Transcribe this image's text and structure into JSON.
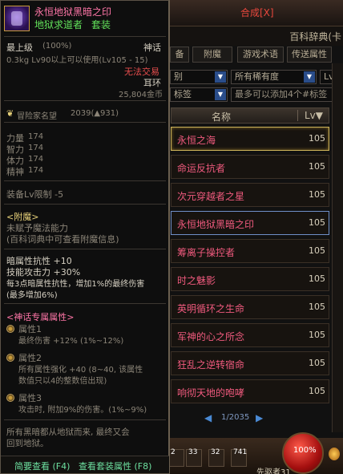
{
  "bg": {
    "title": "合成[X]",
    "subtitle": "百科辞典(卡",
    "tabs": [
      "备",
      "附魔",
      "游戏术语",
      "传送属性"
    ],
    "filters": {
      "left": "别",
      "rarity": "所有稀有度",
      "level": "Lv",
      "tag_left": "标签",
      "tag_right": "最多可以添加4个#标签"
    },
    "columns": {
      "name": "名称",
      "lv": "Lv▼"
    },
    "rows": [
      {
        "name": "永恒之海",
        "lv": "105"
      },
      {
        "name": "命运反抗者",
        "lv": "105"
      },
      {
        "name": "次元穿越者之星",
        "lv": "105"
      },
      {
        "name": "永恒地狱黑暗之印",
        "lv": "105"
      },
      {
        "name": "筹离子操控者",
        "lv": "105"
      },
      {
        "name": "时之魅影",
        "lv": "105"
      },
      {
        "name": "英明循环之生命",
        "lv": "105"
      },
      {
        "name": "军神的心之所念",
        "lv": "105"
      },
      {
        "name": "狂乱之逆转宿命",
        "lv": "105"
      },
      {
        "name": "响彻天地的咆哮",
        "lv": "105"
      }
    ],
    "pager": {
      "text": "1/2035",
      "prev": "◀",
      "next": "▶"
    },
    "hud": {
      "slots": [
        "2",
        "33",
        "32",
        "741"
      ],
      "hp": "100%",
      "fatigue": "先驱者31"
    }
  },
  "tooltip": {
    "name": "永恒地狱黑暗之印",
    "set": "地狱求道者",
    "set_tag": "套装",
    "grade": "最上级",
    "grade_pct": "(100%)",
    "rarity": "神话",
    "weight_req": "0.3kg  Lv90以上可以使用(Lv105 - 15)",
    "trade": "无法交易",
    "slot": "耳环",
    "price": "25,804金币",
    "fame_label": "冒险家名望",
    "fame_value": "2039(▲931)",
    "stats": [
      {
        "label": "力量",
        "value": "174"
      },
      {
        "label": "智力",
        "value": "174"
      },
      {
        "label": "体力",
        "value": "174"
      },
      {
        "label": "精神",
        "value": "174"
      }
    ],
    "lv_limit": "装备Lv限制 -5",
    "enchant_header": "<附魔>",
    "enchant_line1": "未赋予魔法能力",
    "enchant_line2": "(百科词典中可查看附魔信息)",
    "effects": [
      "暗属性抗性 +10",
      "技能攻击力 +30%",
      "每3点暗属性抗性，增加1%的最终伤害",
      "(最多增加6%)"
    ],
    "myth_header": "<神话专属属性>",
    "myth": [
      {
        "title": "属性1",
        "desc": [
          "最终伤害 +12% (1%~12%)"
        ]
      },
      {
        "title": "属性2",
        "desc": [
          "所有属性强化 +40 (8~40, 该属性",
          "数值只以4的整数倍出现)"
        ]
      },
      {
        "title": "属性3",
        "desc": [
          "攻击时, 附加9%的伤害。(1%~9%)"
        ]
      }
    ],
    "flavor": [
      "所有黑暗都从地狱而来, 最终又会",
      "回到地狱。"
    ],
    "footer_left": "简要查看 (F4)",
    "footer_right": "查看套装属性 (F8)"
  }
}
